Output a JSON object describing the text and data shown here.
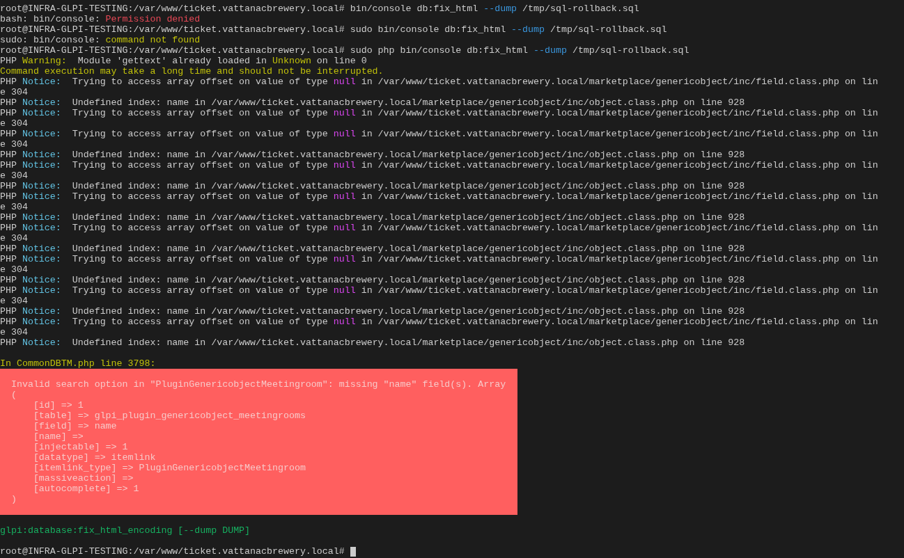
{
  "terminal": {
    "lines": [
      {
        "kind": "text",
        "segments": [
          {
            "text": "root@INFRA-GLPI-TESTING:/var/www/ticket.vattanacbrewery.local# bin/console db:fix_html ",
            "color": "#cccccc"
          },
          {
            "text": "--dump",
            "color": "#3a96dd"
          },
          {
            "text": " /tmp/sql-rollback.sql",
            "color": "#cccccc"
          }
        ]
      },
      {
        "kind": "text",
        "segments": [
          {
            "text": "bash: bin/console: ",
            "color": "#cccccc"
          },
          {
            "text": "Permission denied",
            "color": "#e74856"
          }
        ]
      },
      {
        "kind": "text",
        "segments": [
          {
            "text": "root@INFRA-GLPI-TESTING:/var/www/ticket.vattanacbrewery.local# sudo bin/console db:fix_html ",
            "color": "#cccccc"
          },
          {
            "text": "--dump",
            "color": "#3a96dd"
          },
          {
            "text": " /tmp/sql-rollback.sql",
            "color": "#cccccc"
          }
        ]
      },
      {
        "kind": "text",
        "segments": [
          {
            "text": "sudo: bin/console: ",
            "color": "#cccccc"
          },
          {
            "text": "command not found",
            "color": "#c1c10a"
          }
        ]
      },
      {
        "kind": "text",
        "segments": [
          {
            "text": "root@INFRA-GLPI-TESTING:/var/www/ticket.vattanacbrewery.local# sudo php bin/console db:fix_html ",
            "color": "#cccccc"
          },
          {
            "text": "--dump",
            "color": "#3a96dd"
          },
          {
            "text": " /tmp/sql-rollback.sql",
            "color": "#cccccc"
          }
        ]
      },
      {
        "kind": "text",
        "segments": [
          {
            "text": "PHP ",
            "color": "#cccccc"
          },
          {
            "text": "Warning:",
            "color": "#c1c10a"
          },
          {
            "text": "  Module 'gettext' already loaded in ",
            "color": "#cccccc"
          },
          {
            "text": "Unknown",
            "color": "#c1c10a"
          },
          {
            "text": " on line 0",
            "color": "#cccccc"
          }
        ]
      },
      {
        "kind": "text",
        "segments": [
          {
            "text": "Command execution may take a long time and should not be interrupted.",
            "color": "#c1c10a"
          }
        ]
      },
      {
        "kind": "text",
        "segments": [
          {
            "text": "PHP ",
            "color": "#cccccc"
          },
          {
            "text": "Notice:",
            "color": "#61c0e0"
          },
          {
            "text": "  Trying to access array offset on value of type ",
            "color": "#cccccc"
          },
          {
            "text": "null",
            "color": "#d946ef"
          },
          {
            "text": " in /var/www/ticket.vattanacbrewery.local/marketplace/genericobject/inc/field.class.php on lin",
            "color": "#cccccc"
          }
        ]
      },
      {
        "kind": "text",
        "segments": [
          {
            "text": "e 304",
            "color": "#cccccc"
          }
        ]
      },
      {
        "kind": "text",
        "segments": [
          {
            "text": "PHP ",
            "color": "#cccccc"
          },
          {
            "text": "Notice:",
            "color": "#61c0e0"
          },
          {
            "text": "  Undefined index: name in /var/www/ticket.vattanacbrewery.local/marketplace/genericobject/inc/object.class.php on line 928",
            "color": "#cccccc"
          }
        ]
      },
      {
        "kind": "text",
        "segments": [
          {
            "text": "PHP ",
            "color": "#cccccc"
          },
          {
            "text": "Notice:",
            "color": "#61c0e0"
          },
          {
            "text": "  Trying to access array offset on value of type ",
            "color": "#cccccc"
          },
          {
            "text": "null",
            "color": "#d946ef"
          },
          {
            "text": " in /var/www/ticket.vattanacbrewery.local/marketplace/genericobject/inc/field.class.php on lin",
            "color": "#cccccc"
          }
        ]
      },
      {
        "kind": "text",
        "segments": [
          {
            "text": "e 304",
            "color": "#cccccc"
          }
        ]
      },
      {
        "kind": "text",
        "segments": [
          {
            "text": "PHP ",
            "color": "#cccccc"
          },
          {
            "text": "Notice:",
            "color": "#61c0e0"
          },
          {
            "text": "  Trying to access array offset on value of type ",
            "color": "#cccccc"
          },
          {
            "text": "null",
            "color": "#d946ef"
          },
          {
            "text": " in /var/www/ticket.vattanacbrewery.local/marketplace/genericobject/inc/field.class.php on lin",
            "color": "#cccccc"
          }
        ]
      },
      {
        "kind": "text",
        "segments": [
          {
            "text": "e 304",
            "color": "#cccccc"
          }
        ]
      },
      {
        "kind": "text",
        "segments": [
          {
            "text": "PHP ",
            "color": "#cccccc"
          },
          {
            "text": "Notice:",
            "color": "#61c0e0"
          },
          {
            "text": "  Undefined index: name in /var/www/ticket.vattanacbrewery.local/marketplace/genericobject/inc/object.class.php on line 928",
            "color": "#cccccc"
          }
        ]
      },
      {
        "kind": "text",
        "segments": [
          {
            "text": "PHP ",
            "color": "#cccccc"
          },
          {
            "text": "Notice:",
            "color": "#61c0e0"
          },
          {
            "text": "  Trying to access array offset on value of type ",
            "color": "#cccccc"
          },
          {
            "text": "null",
            "color": "#d946ef"
          },
          {
            "text": " in /var/www/ticket.vattanacbrewery.local/marketplace/genericobject/inc/field.class.php on lin",
            "color": "#cccccc"
          }
        ]
      },
      {
        "kind": "text",
        "segments": [
          {
            "text": "e 304",
            "color": "#cccccc"
          }
        ]
      },
      {
        "kind": "text",
        "segments": [
          {
            "text": "PHP ",
            "color": "#cccccc"
          },
          {
            "text": "Notice:",
            "color": "#61c0e0"
          },
          {
            "text": "  Undefined index: name in /var/www/ticket.vattanacbrewery.local/marketplace/genericobject/inc/object.class.php on line 928",
            "color": "#cccccc"
          }
        ]
      },
      {
        "kind": "text",
        "segments": [
          {
            "text": "PHP ",
            "color": "#cccccc"
          },
          {
            "text": "Notice:",
            "color": "#61c0e0"
          },
          {
            "text": "  Trying to access array offset on value of type ",
            "color": "#cccccc"
          },
          {
            "text": "null",
            "color": "#d946ef"
          },
          {
            "text": " in /var/www/ticket.vattanacbrewery.local/marketplace/genericobject/inc/field.class.php on lin",
            "color": "#cccccc"
          }
        ]
      },
      {
        "kind": "text",
        "segments": [
          {
            "text": "e 304",
            "color": "#cccccc"
          }
        ]
      },
      {
        "kind": "text",
        "segments": [
          {
            "text": "PHP ",
            "color": "#cccccc"
          },
          {
            "text": "Notice:",
            "color": "#61c0e0"
          },
          {
            "text": "  Undefined index: name in /var/www/ticket.vattanacbrewery.local/marketplace/genericobject/inc/object.class.php on line 928",
            "color": "#cccccc"
          }
        ]
      },
      {
        "kind": "text",
        "segments": [
          {
            "text": "PHP ",
            "color": "#cccccc"
          },
          {
            "text": "Notice:",
            "color": "#61c0e0"
          },
          {
            "text": "  Trying to access array offset on value of type ",
            "color": "#cccccc"
          },
          {
            "text": "null",
            "color": "#d946ef"
          },
          {
            "text": " in /var/www/ticket.vattanacbrewery.local/marketplace/genericobject/inc/field.class.php on lin",
            "color": "#cccccc"
          }
        ]
      },
      {
        "kind": "text",
        "segments": [
          {
            "text": "e 304",
            "color": "#cccccc"
          }
        ]
      },
      {
        "kind": "text",
        "segments": [
          {
            "text": "PHP ",
            "color": "#cccccc"
          },
          {
            "text": "Notice:",
            "color": "#61c0e0"
          },
          {
            "text": "  Undefined index: name in /var/www/ticket.vattanacbrewery.local/marketplace/genericobject/inc/object.class.php on line 928",
            "color": "#cccccc"
          }
        ]
      },
      {
        "kind": "text",
        "segments": [
          {
            "text": "PHP ",
            "color": "#cccccc"
          },
          {
            "text": "Notice:",
            "color": "#61c0e0"
          },
          {
            "text": "  Trying to access array offset on value of type ",
            "color": "#cccccc"
          },
          {
            "text": "null",
            "color": "#d946ef"
          },
          {
            "text": " in /var/www/ticket.vattanacbrewery.local/marketplace/genericobject/inc/field.class.php on lin",
            "color": "#cccccc"
          }
        ]
      },
      {
        "kind": "text",
        "segments": [
          {
            "text": "e 304",
            "color": "#cccccc"
          }
        ]
      },
      {
        "kind": "text",
        "segments": [
          {
            "text": "PHP ",
            "color": "#cccccc"
          },
          {
            "text": "Notice:",
            "color": "#61c0e0"
          },
          {
            "text": "  Undefined index: name in /var/www/ticket.vattanacbrewery.local/marketplace/genericobject/inc/object.class.php on line 928",
            "color": "#cccccc"
          }
        ]
      },
      {
        "kind": "text",
        "segments": [
          {
            "text": "PHP ",
            "color": "#cccccc"
          },
          {
            "text": "Notice:",
            "color": "#61c0e0"
          },
          {
            "text": "  Trying to access array offset on value of type ",
            "color": "#cccccc"
          },
          {
            "text": "null",
            "color": "#d946ef"
          },
          {
            "text": " in /var/www/ticket.vattanacbrewery.local/marketplace/genericobject/inc/field.class.php on lin",
            "color": "#cccccc"
          }
        ]
      },
      {
        "kind": "text",
        "segments": [
          {
            "text": "e 304",
            "color": "#cccccc"
          }
        ]
      },
      {
        "kind": "text",
        "segments": [
          {
            "text": "PHP ",
            "color": "#cccccc"
          },
          {
            "text": "Notice:",
            "color": "#61c0e0"
          },
          {
            "text": "  Undefined index: name in /var/www/ticket.vattanacbrewery.local/marketplace/genericobject/inc/object.class.php on line 928",
            "color": "#cccccc"
          }
        ]
      },
      {
        "kind": "text",
        "segments": [
          {
            "text": "PHP ",
            "color": "#cccccc"
          },
          {
            "text": "Notice:",
            "color": "#61c0e0"
          },
          {
            "text": "  Trying to access array offset on value of type ",
            "color": "#cccccc"
          },
          {
            "text": "null",
            "color": "#d946ef"
          },
          {
            "text": " in /var/www/ticket.vattanacbrewery.local/marketplace/genericobject/inc/field.class.php on lin",
            "color": "#cccccc"
          }
        ]
      },
      {
        "kind": "text",
        "segments": [
          {
            "text": "e 304",
            "color": "#cccccc"
          }
        ]
      },
      {
        "kind": "text",
        "segments": [
          {
            "text": "PHP ",
            "color": "#cccccc"
          },
          {
            "text": "Notice:",
            "color": "#61c0e0"
          },
          {
            "text": "  Undefined index: name in /var/www/ticket.vattanacbrewery.local/marketplace/genericobject/inc/object.class.php on line 928",
            "color": "#cccccc"
          }
        ]
      },
      {
        "kind": "blank"
      },
      {
        "kind": "text",
        "segments": [
          {
            "text": "In CommonDBTM.php line 3798:",
            "color": "#c1c10a"
          }
        ]
      },
      {
        "kind": "error",
        "lines": [
          "  Invalid search option in \"PluginGenericobjectMeetingroom\": missing \"name\" field(s). Array",
          "  (",
          "      [id] => 1",
          "      [table] => glpi_plugin_genericobject_meetingrooms",
          "      [field] => name",
          "      [name] =>",
          "      [injectable] => 1",
          "      [datatype] => itemlink",
          "      [itemlink_type] => PluginGenericobjectMeetingroom",
          "      [massiveaction] =>",
          "      [autocomplete] => 1",
          "  )"
        ]
      },
      {
        "kind": "blank"
      },
      {
        "kind": "text",
        "segments": [
          {
            "text": "glpi:database:fix_html_encoding [--dump DUMP]",
            "color": "#16b060"
          }
        ]
      },
      {
        "kind": "blank"
      },
      {
        "kind": "prompt",
        "text": "root@INFRA-GLPI-TESTING:/var/www/ticket.vattanacbrewery.local# ",
        "cursor": true
      }
    ]
  }
}
